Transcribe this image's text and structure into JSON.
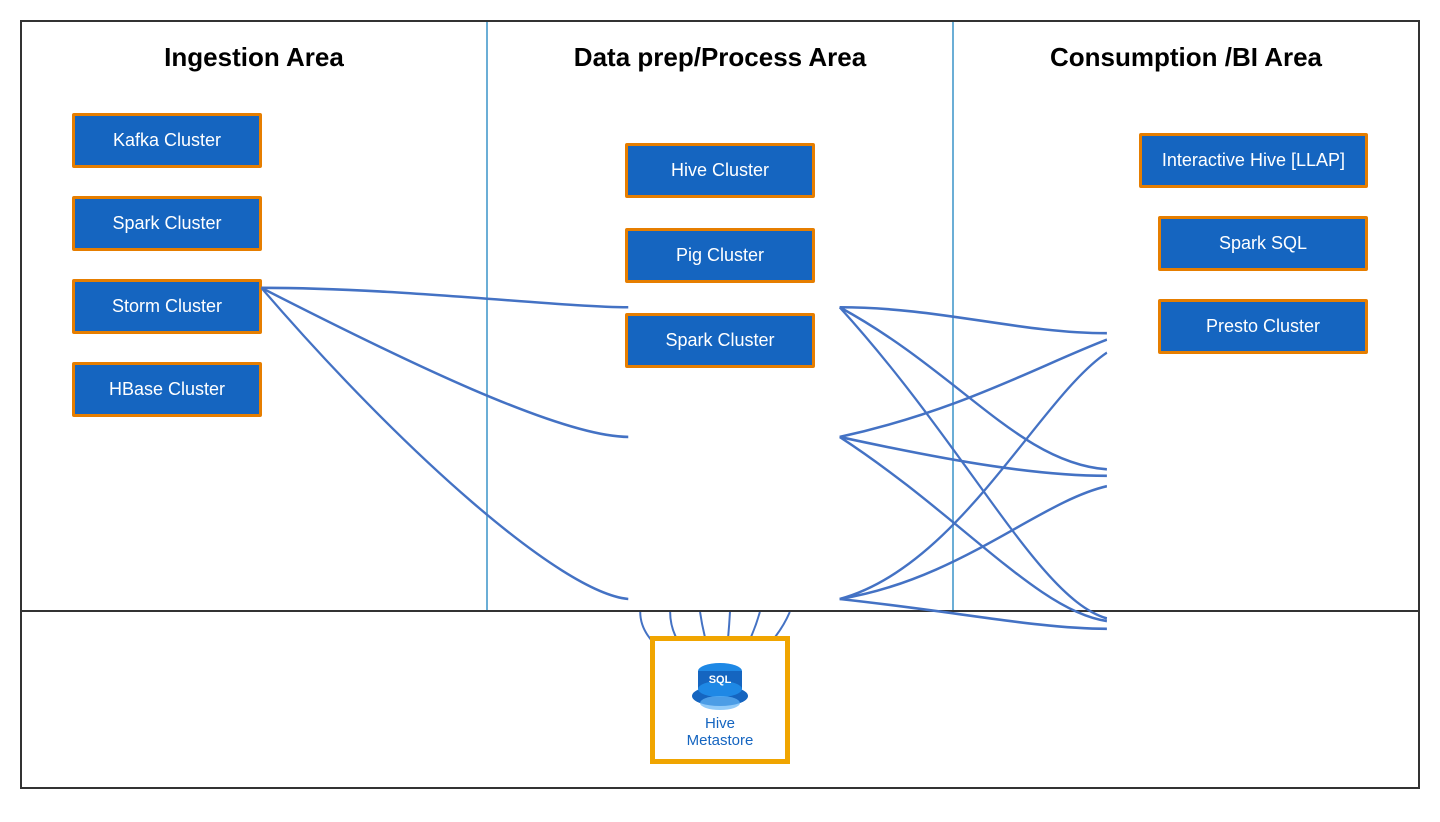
{
  "columns": {
    "ingestion": {
      "title": "Ingestion Area",
      "boxes": [
        "Kafka Cluster",
        "Spark Cluster",
        "Storm Cluster",
        "HBase Cluster"
      ]
    },
    "process": {
      "title": "Data prep/Process Area",
      "boxes": [
        "Hive Cluster",
        "Pig Cluster",
        "Spark Cluster"
      ]
    },
    "consumption": {
      "title": "Consumption /BI Area",
      "boxes": [
        "Interactive Hive [LLAP]",
        "Spark SQL",
        "Presto Cluster"
      ]
    }
  },
  "metastore": {
    "label": "Hive Metastore"
  },
  "colors": {
    "box_bg": "#1565c0",
    "box_border": "#e67e00",
    "arrow": "#4472c4",
    "metastore_border": "#f0a500"
  }
}
